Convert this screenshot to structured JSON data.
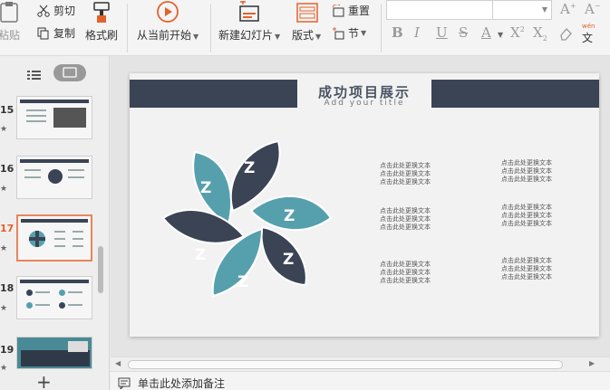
{
  "ribbon": {
    "paste_label": "粘贴",
    "cut_label": "剪切",
    "copy_label": "复制",
    "format_painter_label": "格式刷",
    "from_current_label": "从当前开始",
    "new_slide_label": "新建幻灯片",
    "layout_label": "版式",
    "reset_label": "重置",
    "section_label": "节",
    "font_grow": "A",
    "font_shrink": "A",
    "pinyin": "wén"
  },
  "slides_panel": {
    "thumbnails": [
      {
        "number": "15"
      },
      {
        "number": "16"
      },
      {
        "number": "17"
      },
      {
        "number": "18"
      },
      {
        "number": "19"
      }
    ]
  },
  "slide": {
    "title": "成功项目展示",
    "subtitle": "Add your title",
    "petal_letter": "Z",
    "placeholder_line": "点击此处更换文本",
    "colors": {
      "dark": "#3b4455",
      "teal": "#56a0ad"
    }
  },
  "notes": {
    "placeholder": "单击此处添加备注"
  }
}
